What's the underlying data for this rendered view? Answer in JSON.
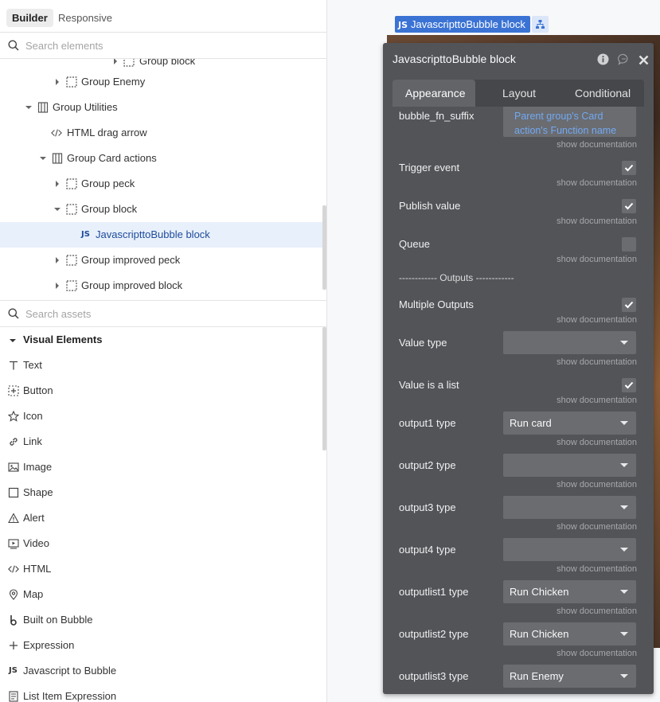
{
  "header": {
    "tabs": [
      {
        "label": "Builder",
        "active": true
      },
      {
        "label": "Responsive",
        "active": false
      }
    ]
  },
  "element_search": {
    "placeholder": "Search elements"
  },
  "tree": {
    "items": [
      {
        "label": "Group block",
        "icon": "group-icon",
        "caret": "right"
      },
      {
        "label": "Group Enemy",
        "icon": "group-icon",
        "caret": "right"
      },
      {
        "label": "Group Utilities",
        "icon": "column-group-icon",
        "caret": "down"
      },
      {
        "label": "HTML drag arrow",
        "icon": "html-icon",
        "caret": "none"
      },
      {
        "label": "Group Card actions",
        "icon": "column-group-icon",
        "caret": "down"
      },
      {
        "label": "Group peck",
        "icon": "group-icon",
        "caret": "right"
      },
      {
        "label": "Group block",
        "icon": "group-icon",
        "caret": "down"
      },
      {
        "label": "JavascripttoBubble block",
        "icon": "js-icon",
        "caret": "none",
        "selected": true
      },
      {
        "label": "Group improved peck",
        "icon": "group-icon",
        "caret": "right"
      },
      {
        "label": "Group improved block",
        "icon": "group-icon",
        "caret": "right"
      }
    ]
  },
  "asset_search": {
    "placeholder": "Search assets"
  },
  "assets": {
    "section_title": "Visual Elements",
    "items": [
      {
        "label": "Text",
        "icon": "text-icon"
      },
      {
        "label": "Button",
        "icon": "button-icon"
      },
      {
        "label": "Icon",
        "icon": "star-icon"
      },
      {
        "label": "Link",
        "icon": "link-icon"
      },
      {
        "label": "Image",
        "icon": "image-icon"
      },
      {
        "label": "Shape",
        "icon": "shape-icon"
      },
      {
        "label": "Alert",
        "icon": "alert-icon"
      },
      {
        "label": "Video",
        "icon": "video-icon"
      },
      {
        "label": "HTML",
        "icon": "html-icon"
      },
      {
        "label": "Map",
        "icon": "map-pin-icon"
      },
      {
        "label": "Built on Bubble",
        "icon": "bubble-logo-icon"
      },
      {
        "label": "Expression",
        "icon": "plus-icon"
      },
      {
        "label": "Javascript to Bubble",
        "icon": "js-icon"
      },
      {
        "label": "List Item Expression",
        "icon": "list-icon"
      }
    ]
  },
  "canvas": {
    "element_label": "JavascripttoBubble block",
    "js_badge": "JS"
  },
  "editor": {
    "title": "JavascripttoBubble block",
    "tabs": [
      {
        "label": "Appearance",
        "active": true
      },
      {
        "label": "Layout",
        "active": false
      },
      {
        "label": "Conditional",
        "active": false
      }
    ],
    "doc_link": "show documentation",
    "fields": {
      "bubble_fn_suffix": {
        "label": "bubble_fn_suffix",
        "value": "Parent group's Card action's Function name"
      },
      "trigger_event": {
        "label": "Trigger event",
        "checked": true
      },
      "publish_value": {
        "label": "Publish value",
        "checked": true
      },
      "queue": {
        "label": "Queue",
        "checked": false
      },
      "outputs_separator": "------------ Outputs ------------",
      "multiple_outputs": {
        "label": "Multiple Outputs",
        "checked": true
      },
      "value_type": {
        "label": "Value type",
        "value": ""
      },
      "value_is_list": {
        "label": "Value is a list",
        "checked": true
      },
      "output1_type": {
        "label": "output1 type",
        "value": "Run card"
      },
      "output2_type": {
        "label": "output2 type",
        "value": ""
      },
      "output3_type": {
        "label": "output3 type",
        "value": ""
      },
      "output4_type": {
        "label": "output4 type",
        "value": ""
      },
      "outputlist1_type": {
        "label": "outputlist1 type",
        "value": "Run Chicken"
      },
      "outputlist2_type": {
        "label": "outputlist2 type",
        "value": "Run Chicken"
      },
      "outputlist3_type": {
        "label": "outputlist3 type",
        "value": "Run Enemy"
      }
    }
  },
  "colors": {
    "accent": "#3b73d4",
    "editor_bg": "#525458",
    "dynamic_text": "#73a9f2",
    "selected_row": "#e8f0fb"
  }
}
